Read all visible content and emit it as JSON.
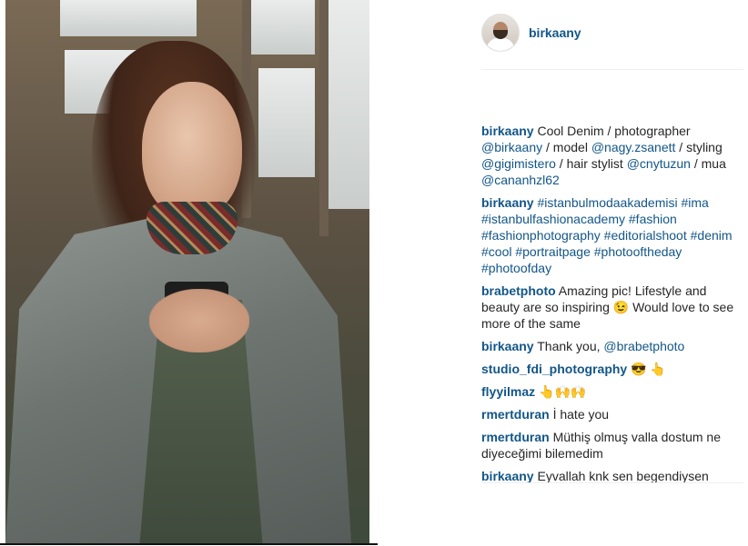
{
  "post": {
    "author": "birkaany"
  },
  "comments": [
    {
      "user": "birkaany",
      "parts": [
        {
          "t": "text",
          "v": "Cool Denim / photographer "
        },
        {
          "t": "link",
          "v": "@birkaany"
        },
        {
          "t": "text",
          "v": " / model "
        },
        {
          "t": "link",
          "v": "@nagy.zsanett"
        },
        {
          "t": "text",
          "v": " / styling "
        },
        {
          "t": "link",
          "v": "@gigimistero"
        },
        {
          "t": "text",
          "v": " / hair stylist "
        },
        {
          "t": "link",
          "v": "@cnytuzun"
        },
        {
          "t": "text",
          "v": " / mua "
        },
        {
          "t": "link",
          "v": "@cananhzl62"
        }
      ]
    },
    {
      "user": "birkaany",
      "parts": [
        {
          "t": "link",
          "v": "#istanbulmodaakademisi"
        },
        {
          "t": "text",
          "v": " "
        },
        {
          "t": "link",
          "v": "#ima"
        },
        {
          "t": "text",
          "v": " "
        },
        {
          "t": "link",
          "v": "#istanbulfashionacademy"
        },
        {
          "t": "text",
          "v": " "
        },
        {
          "t": "link",
          "v": "#fashion"
        },
        {
          "t": "text",
          "v": " "
        },
        {
          "t": "link",
          "v": "#fashionphotography"
        },
        {
          "t": "text",
          "v": " "
        },
        {
          "t": "link",
          "v": "#editorialshoot"
        },
        {
          "t": "text",
          "v": " "
        },
        {
          "t": "link",
          "v": "#denim"
        },
        {
          "t": "text",
          "v": " "
        },
        {
          "t": "link",
          "v": "#cool"
        },
        {
          "t": "text",
          "v": " "
        },
        {
          "t": "link",
          "v": "#portraitpage"
        },
        {
          "t": "text",
          "v": " "
        },
        {
          "t": "link",
          "v": "#photooftheday"
        },
        {
          "t": "text",
          "v": " "
        },
        {
          "t": "link",
          "v": "#photoofday"
        }
      ]
    },
    {
      "user": "brabetphoto",
      "parts": [
        {
          "t": "text",
          "v": "Amazing pic! Lifestyle and beauty are so inspiring 😉 Would love to see more of the same"
        }
      ]
    },
    {
      "user": "birkaany",
      "parts": [
        {
          "t": "text",
          "v": "Thank you, "
        },
        {
          "t": "link",
          "v": "@brabetphoto"
        }
      ]
    },
    {
      "user": "studio_fdi_photography",
      "parts": [
        {
          "t": "text",
          "v": "😎 👆"
        }
      ]
    },
    {
      "user": "flyyilmaz",
      "parts": [
        {
          "t": "text",
          "v": "👆🙌🙌"
        }
      ]
    },
    {
      "user": "rmertduran",
      "parts": [
        {
          "t": "text",
          "v": "İ hate you"
        }
      ]
    },
    {
      "user": "rmertduran",
      "parts": [
        {
          "t": "text",
          "v": "Müthiş olmuş valla dostum ne diyeceğimi bilemedim"
        }
      ]
    },
    {
      "user": "birkaany",
      "parts": [
        {
          "t": "text",
          "v": "Eyvallah knk sen begendiysen"
        }
      ]
    }
  ],
  "colors": {
    "link": "#125688",
    "text": "#262626",
    "divider": "#efefef"
  }
}
